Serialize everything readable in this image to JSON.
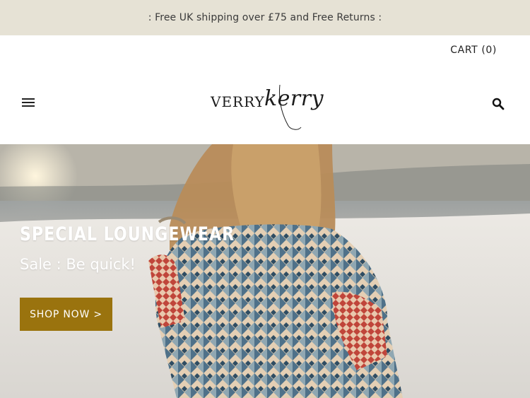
{
  "announcement": {
    "text": ": Free UK shipping over £75 and Free Returns :"
  },
  "header": {
    "cart_label": "CART (0)",
    "logo": {
      "word1": "VERRY",
      "word2": "kerry"
    },
    "icons": {
      "menu": "hamburger-menu-icon",
      "search": "search-icon"
    }
  },
  "hero": {
    "title": "SPECIAL LOUNGEWEAR",
    "subtitle": "Sale : Be quick!",
    "button_label": "SHOP NOW >",
    "button_color": "#9a730e"
  },
  "colors": {
    "announcement_bg": "#e6e2d5",
    "text": "#222222"
  }
}
